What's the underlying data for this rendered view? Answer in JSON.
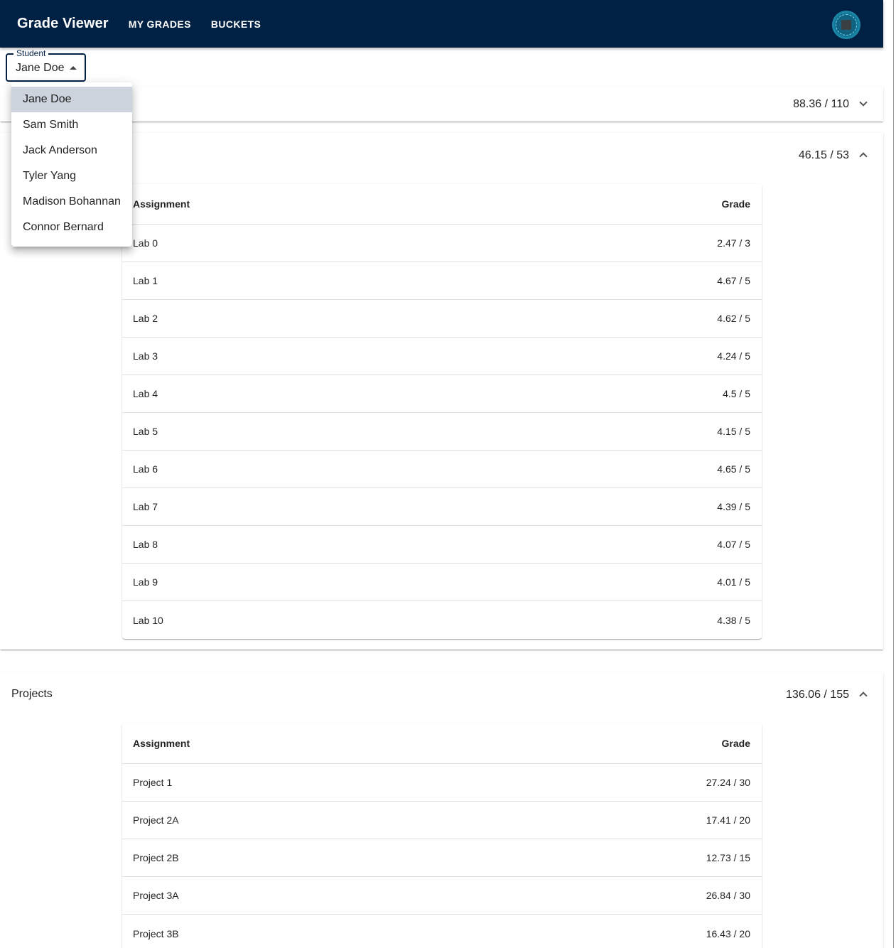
{
  "appbar": {
    "title": "Grade Viewer",
    "nav": [
      "MY GRADES",
      "BUCKETS"
    ]
  },
  "student_select": {
    "label": "Student",
    "value": "Jane Doe",
    "options": [
      "Jane Doe",
      "Sam Smith",
      "Jack Anderson",
      "Tyler Yang",
      "Madison Bohannan",
      "Connor Bernard"
    ]
  },
  "sections": [
    {
      "title": "",
      "score": "88.36 / 110",
      "expanded": false
    },
    {
      "title": "",
      "score": "46.15 / 53",
      "expanded": true,
      "columns": [
        "Assignment",
        "Grade"
      ],
      "rows": [
        [
          "Lab 0",
          "2.47 / 3"
        ],
        [
          "Lab 1",
          "4.67 / 5"
        ],
        [
          "Lab 2",
          "4.62 / 5"
        ],
        [
          "Lab 3",
          "4.24 / 5"
        ],
        [
          "Lab 4",
          "4.5 / 5"
        ],
        [
          "Lab 5",
          "4.15 / 5"
        ],
        [
          "Lab 6",
          "4.65 / 5"
        ],
        [
          "Lab 7",
          "4.39 / 5"
        ],
        [
          "Lab 8",
          "4.07 / 5"
        ],
        [
          "Lab 9",
          "4.01 / 5"
        ],
        [
          "Lab 10",
          "4.38 / 5"
        ]
      ]
    },
    {
      "title": "Projects",
      "score": "136.06 / 155",
      "expanded": true,
      "columns": [
        "Assignment",
        "Grade"
      ],
      "rows": [
        [
          "Project 1",
          "27.24 / 30"
        ],
        [
          "Project 2A",
          "17.41 / 20"
        ],
        [
          "Project 2B",
          "12.73 / 15"
        ],
        [
          "Project 3A",
          "26.84 / 30"
        ],
        [
          "Project 3B",
          "16.43 / 20"
        ]
      ]
    }
  ]
}
